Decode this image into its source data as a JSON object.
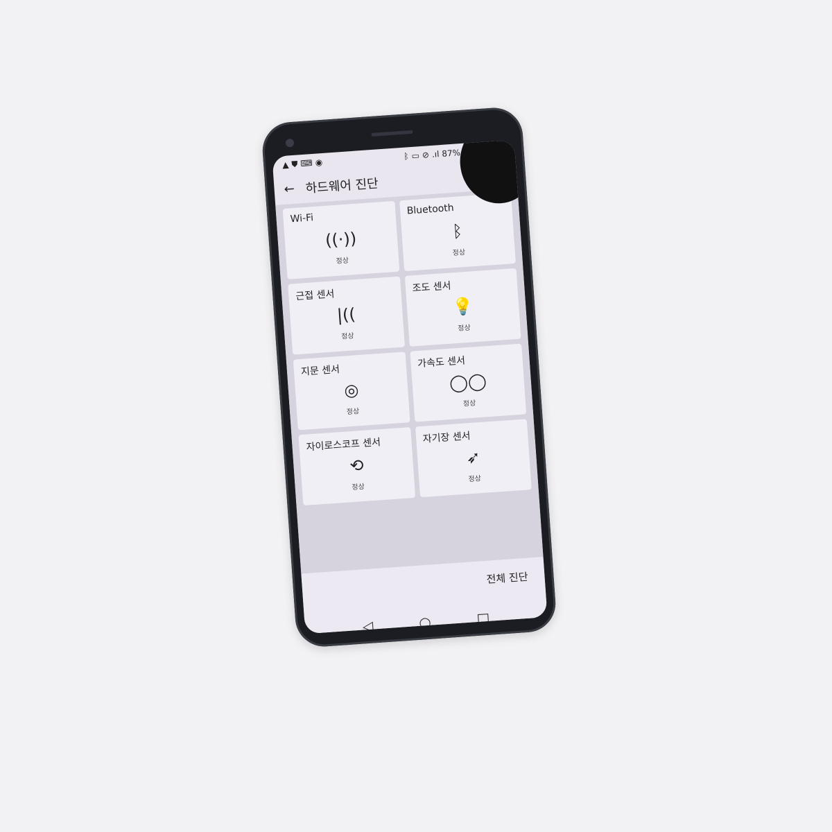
{
  "status_bar": {
    "left_icons": [
      "warning-icon",
      "shield-icon",
      "keyboard-icon",
      "sync-icon"
    ],
    "battery": "87%",
    "right_icons": [
      "bluetooth-icon",
      "nfc-icon",
      "no-sim-icon",
      "signal-icon",
      "battery-icon"
    ]
  },
  "header": {
    "title": "하드웨어 진단"
  },
  "tiles": [
    {
      "title": "Wi-Fi",
      "icon": "wifi-icon",
      "glyph": "((·))",
      "status": "정상"
    },
    {
      "title": "Bluetooth",
      "icon": "bluetooth-icon",
      "glyph": "ᛒ",
      "status": "정상"
    },
    {
      "title": "근접 센서",
      "icon": "proximity-icon",
      "glyph": "|((",
      "status": "정상"
    },
    {
      "title": "조도 센서",
      "icon": "light-bulb-icon",
      "glyph": "💡",
      "status": "정상"
    },
    {
      "title": "지문 센서",
      "icon": "fingerprint-icon",
      "glyph": "◎",
      "status": "정상"
    },
    {
      "title": "가속도 센서",
      "icon": "accelerometer-icon",
      "glyph": "◯◯",
      "status": "정상"
    },
    {
      "title": "자이로스코프 센서",
      "icon": "gyroscope-icon",
      "glyph": "⟲",
      "status": "정상"
    },
    {
      "title": "자기장 센서",
      "icon": "compass-icon",
      "glyph": "➶",
      "status": "정상"
    }
  ],
  "footer": {
    "run_all": "전체 진단"
  },
  "nav": {
    "back": "◁",
    "home": "○",
    "recents": "□"
  }
}
